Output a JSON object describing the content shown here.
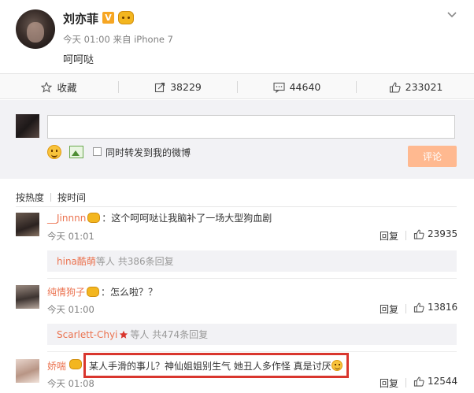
{
  "post": {
    "username": "刘亦菲",
    "verified_badge": "V",
    "vip_icon": "vip-face-icon",
    "time": "今天 01:00",
    "source": "来自 iPhone 7",
    "text": "呵呵哒"
  },
  "actions": {
    "favorite_label": "收藏",
    "repost_count": "38229",
    "comment_count": "44640",
    "like_count": "233021"
  },
  "composer": {
    "input_value": "",
    "repost_label": "同时转发到我的微博",
    "submit_label": "评论"
  },
  "sort": {
    "hot": "按热度",
    "time": "按时间"
  },
  "comments": [
    {
      "name": "__Jinnnn",
      "text": "：这个呵呵哒让我脑补了一场大型狗血剧",
      "time": "今天 01:01",
      "reply": "回复",
      "likes": "23935",
      "sub_name": "hina酷萌",
      "sub_text": " 等人 共386条回复"
    },
    {
      "name": "纯情狗子",
      "text": "：怎么啦？？",
      "time": "今天 01:00",
      "reply": "回复",
      "likes": "13816",
      "sub_name": "Scarlett-Chyi",
      "sub_text": " 等人 共474条回复"
    },
    {
      "name": "娇喘",
      "text": "某人手滑的事儿？神仙姐姐别生气 她丑人多作怪 真是讨厌",
      "time": "今天 01:08",
      "reply": "回复",
      "likes": "12544"
    }
  ],
  "colors": {
    "accent": "#eb7350",
    "submit": "#ffb990",
    "highlight": "#d9362e"
  }
}
